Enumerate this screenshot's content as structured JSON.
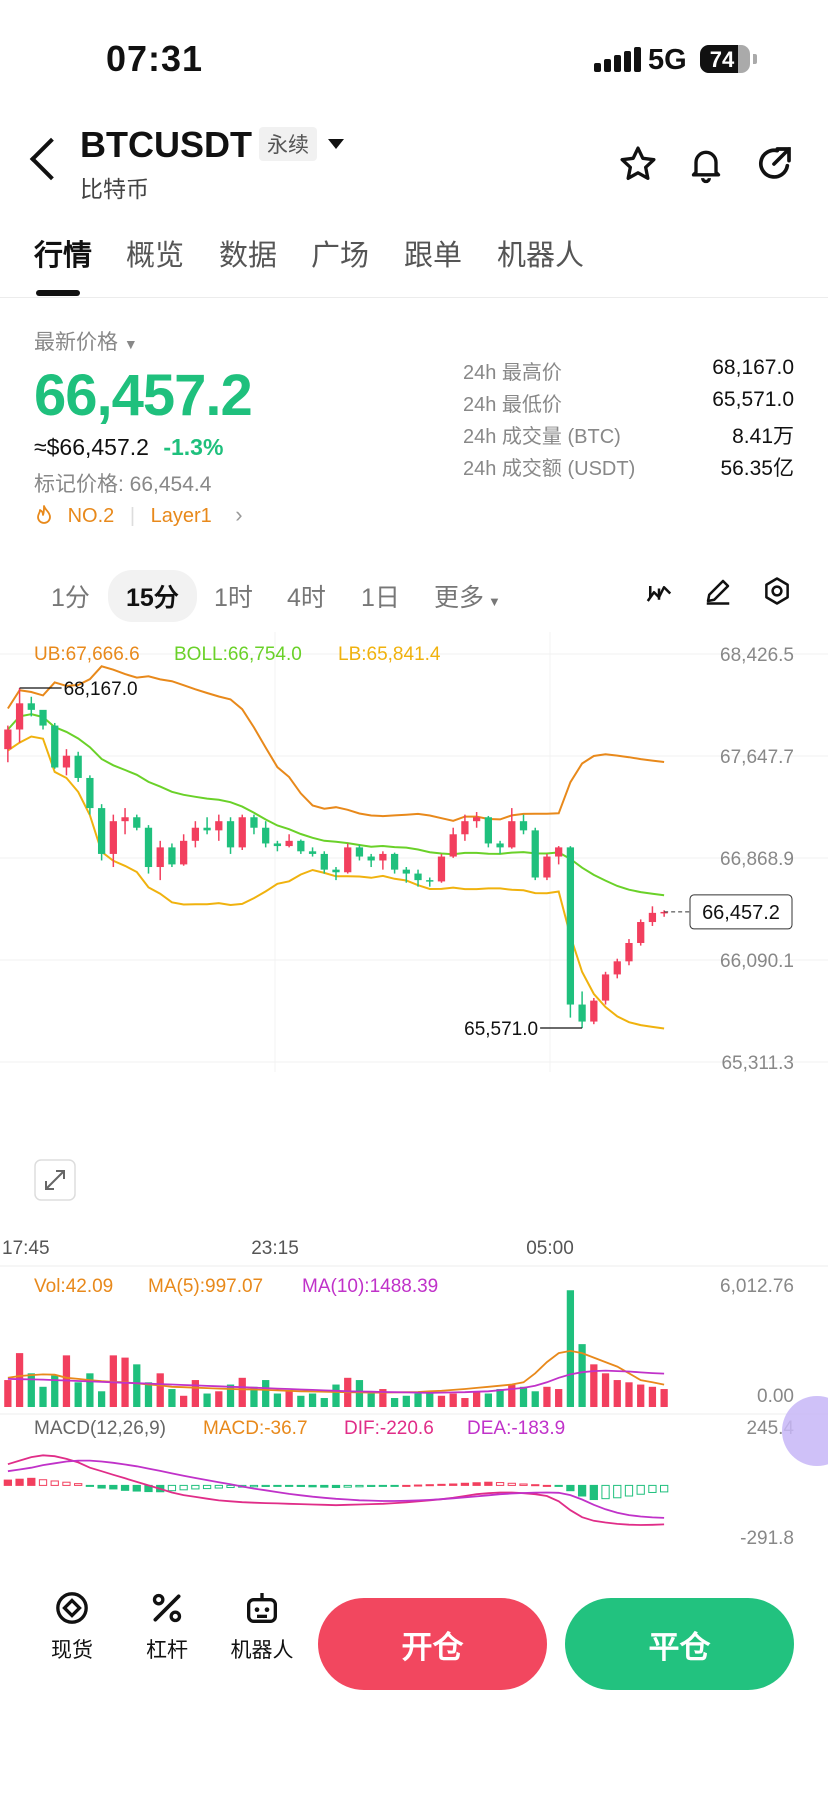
{
  "status": {
    "time": "07:31",
    "network": "5G",
    "battery": "74"
  },
  "header": {
    "symbol": "BTCUSDT",
    "contract_tag": "永续",
    "subtitle": "比特币"
  },
  "tabs": [
    "行情",
    "概览",
    "数据",
    "广场",
    "跟单",
    "机器人"
  ],
  "quote": {
    "label": "最新价格",
    "price": "66,457.2",
    "usd_price": "≈$66,457.2",
    "change": "-1.3%",
    "mark_price": "标记价格: 66,454.4",
    "rank": "NO.2",
    "category": "Layer1"
  },
  "stats": [
    {
      "label": "24h 最高价",
      "value": "68,167.0"
    },
    {
      "label": "24h 最低价",
      "value": "65,571.0"
    },
    {
      "label": "24h 成交量 (BTC)",
      "value": "8.41万"
    },
    {
      "label": "24h 成交额 (USDT)",
      "value": "56.35亿"
    }
  ],
  "intervals": [
    "1分",
    "15分",
    "1时",
    "4时",
    "1日",
    "更多"
  ],
  "intervals_active": "15分",
  "toolbar_icons": [
    "indicator-icon",
    "draw-pen-icon",
    "settings-icon"
  ],
  "colors": {
    "up": "#f23f5e",
    "down": "#1fc07d",
    "ub": "#e8891b",
    "boll": "#6ad129",
    "lb": "#f0b20e",
    "ma10": "#c032c9"
  },
  "chart_data": {
    "type": "candlestick",
    "interval": "15分",
    "boll": {
      "ub": "UB:67,666.6",
      "mid": "BOLL:66,754.0",
      "lb": "LB:65,841.4"
    },
    "price_axis": [
      "68,426.5",
      "67,647.7",
      "66,868.9",
      "66,090.1",
      "65,311.3"
    ],
    "ylim": [
      65311.3,
      68426.5
    ],
    "current_price": "66,457.2",
    "high_marker": "68,167.0",
    "low_marker": "65,571.0",
    "x_labels": [
      "17:45",
      "23:15",
      "05:00"
    ],
    "candles": [
      [
        67700,
        67880,
        67600,
        67850
      ],
      [
        67850,
        68167,
        67750,
        68050
      ],
      [
        68050,
        68100,
        67950,
        68000
      ],
      [
        68000,
        67980,
        67850,
        67880
      ],
      [
        67880,
        67900,
        67550,
        67560
      ],
      [
        67560,
        67700,
        67500,
        67650
      ],
      [
        67650,
        67680,
        67450,
        67480
      ],
      [
        67480,
        67500,
        67200,
        67250
      ],
      [
        67250,
        67280,
        66850,
        66900
      ],
      [
        66900,
        67200,
        66800,
        67150
      ],
      [
        67150,
        67250,
        67050,
        67180
      ],
      [
        67180,
        67200,
        67080,
        67100
      ],
      [
        67100,
        67120,
        66750,
        66800
      ],
      [
        66800,
        67000,
        66700,
        66950
      ],
      [
        66950,
        66980,
        66800,
        66820
      ],
      [
        66820,
        67050,
        66810,
        67000
      ],
      [
        67000,
        67150,
        66950,
        67100
      ],
      [
        67100,
        67180,
        67050,
        67080
      ],
      [
        67080,
        67200,
        67000,
        67150
      ],
      [
        67150,
        67180,
        66900,
        66950
      ],
      [
        66950,
        67200,
        66930,
        67180
      ],
      [
        67180,
        67200,
        67050,
        67100
      ],
      [
        67100,
        67150,
        66950,
        66980
      ],
      [
        66980,
        67000,
        66920,
        66960
      ],
      [
        66960,
        67050,
        66950,
        67000
      ],
      [
        67000,
        67010,
        66900,
        66920
      ],
      [
        66920,
        66950,
        66880,
        66900
      ],
      [
        66900,
        66920,
        66750,
        66780
      ],
      [
        66780,
        66800,
        66700,
        66760
      ],
      [
        66760,
        66980,
        66750,
        66950
      ],
      [
        66950,
        66970,
        66850,
        66880
      ],
      [
        66880,
        66900,
        66800,
        66850
      ],
      [
        66850,
        66920,
        66780,
        66900
      ],
      [
        66900,
        66910,
        66750,
        66780
      ],
      [
        66780,
        66800,
        66680,
        66750
      ],
      [
        66750,
        66780,
        66650,
        66700
      ],
      [
        66700,
        66720,
        66650,
        66690
      ],
      [
        66690,
        66900,
        66680,
        66880
      ],
      [
        66880,
        67100,
        66870,
        67050
      ],
      [
        67050,
        67200,
        67000,
        67150
      ],
      [
        67150,
        67220,
        67100,
        67180
      ],
      [
        67180,
        67190,
        66950,
        66980
      ],
      [
        66980,
        67000,
        66900,
        66950
      ],
      [
        66950,
        67250,
        66940,
        67150
      ],
      [
        67150,
        67200,
        67050,
        67080
      ],
      [
        67080,
        67100,
        66700,
        66720
      ],
      [
        66720,
        66900,
        66700,
        66880
      ],
      [
        66880,
        66960,
        66820,
        66950
      ],
      [
        66950,
        66960,
        65650,
        65750
      ],
      [
        65750,
        65850,
        65571,
        65620
      ],
      [
        65620,
        65800,
        65600,
        65780
      ],
      [
        65780,
        66000,
        65750,
        65980
      ],
      [
        65980,
        66100,
        65950,
        66080
      ],
      [
        66080,
        66250,
        66050,
        66220
      ],
      [
        66220,
        66400,
        66200,
        66380
      ],
      [
        66380,
        66500,
        66350,
        66450
      ],
      [
        66450,
        66470,
        66420,
        66457.2
      ]
    ],
    "volume": {
      "labels": [
        "Vol:42.09",
        "MA(5):997.07",
        "MA(10):1488.39"
      ],
      "axis": [
        "6,012.76",
        "0.00"
      ],
      "ylim": [
        0,
        6012.76
      ],
      "values": [
        1200,
        2400,
        1500,
        900,
        1400,
        2300,
        1100,
        1500,
        700,
        2300,
        2200,
        1900,
        1100,
        1500,
        800,
        500,
        1200,
        600,
        700,
        1000,
        1300,
        900,
        1200,
        600,
        700,
        500,
        600,
        400,
        1000,
        1300,
        1200,
        600,
        800,
        400,
        500,
        600,
        700,
        500,
        600,
        400,
        700,
        600,
        800,
        1000,
        900,
        700,
        900,
        800,
        5200,
        2800,
        1900,
        1500,
        1200,
        1100,
        1000,
        900,
        800
      ],
      "ma5": [
        1300,
        1380,
        1420,
        1450,
        1440,
        1300,
        1250,
        1200,
        1150,
        1120,
        1100,
        1050,
        1000,
        960,
        900,
        880,
        860,
        840,
        820,
        800,
        790,
        780,
        760,
        740,
        720,
        700,
        690,
        680,
        670,
        660,
        650,
        640,
        640,
        650,
        660,
        670,
        700,
        720,
        760,
        800,
        850,
        900,
        950,
        1000,
        1100,
        1500,
        2000,
        2400,
        2500,
        2400,
        2200,
        2000,
        1800,
        1500,
        1200,
        1100,
        997.07
      ],
      "ma10": [
        1250,
        1240,
        1230,
        1220,
        1200,
        1180,
        1160,
        1140,
        1120,
        1100,
        1080,
        1060,
        1040,
        1020,
        1000,
        980,
        960,
        940,
        920,
        900,
        880,
        860,
        840,
        820,
        800,
        780,
        760,
        740,
        720,
        700,
        690,
        680,
        670,
        660,
        650,
        640,
        630,
        640,
        650,
        660,
        680,
        700,
        750,
        800,
        850,
        950,
        1100,
        1300,
        1450,
        1550,
        1600,
        1620,
        1600,
        1580,
        1540,
        1510,
        1488.39
      ]
    },
    "macd": {
      "labels": [
        "MACD(12,26,9)",
        "MACD:-36.7",
        "DIF:-220.6",
        "DEA:-183.9"
      ],
      "axis": [
        "245.4",
        "-291.8"
      ],
      "ylim": [
        -291.8,
        245.4
      ],
      "hist": [
        30,
        35,
        40,
        32,
        25,
        18,
        10,
        -5,
        -15,
        -20,
        -28,
        -32,
        -35,
        -36,
        -30,
        -25,
        -20,
        -18,
        -15,
        -12,
        -10,
        -8,
        -6,
        -5,
        -4,
        -6,
        -8,
        -10,
        -12,
        -10,
        -8,
        -6,
        -4,
        -2,
        0,
        2,
        4,
        6,
        8,
        12,
        15,
        18,
        16,
        12,
        8,
        4,
        0,
        -5,
        -30,
        -60,
        -80,
        -75,
        -70,
        -60,
        -50,
        -40,
        -36.7
      ],
      "dif": [
        120,
        140,
        160,
        170,
        165,
        150,
        130,
        100,
        80,
        60,
        40,
        20,
        0,
        -20,
        -40,
        -55,
        -65,
        -75,
        -85,
        -90,
        -95,
        -98,
        -100,
        -102,
        -104,
        -106,
        -108,
        -110,
        -112,
        -110,
        -108,
        -106,
        -104,
        -100,
        -96,
        -90,
        -84,
        -78,
        -70,
        -60,
        -50,
        -44,
        -40,
        -40,
        -44,
        -50,
        -60,
        -90,
        -140,
        -180,
        -200,
        -210,
        -218,
        -222,
        -224,
        -223,
        -220.6
      ],
      "dea": [
        80,
        90,
        100,
        115,
        125,
        135,
        140,
        140,
        135,
        128,
        118,
        108,
        95,
        82,
        68,
        55,
        42,
        30,
        18,
        6,
        -6,
        -18,
        -28,
        -38,
        -48,
        -56,
        -64,
        -70,
        -76,
        -80,
        -84,
        -86,
        -88,
        -88,
        -87,
        -85,
        -82,
        -78,
        -73,
        -68,
        -62,
        -56,
        -50,
        -46,
        -43,
        -41,
        -40,
        -42,
        -55,
        -80,
        -110,
        -135,
        -155,
        -168,
        -176,
        -181,
        -183.9
      ]
    }
  },
  "bottom_nav": [
    {
      "label": "现货",
      "icon": "spot-icon"
    },
    {
      "label": "杠杆",
      "icon": "leverage-icon"
    },
    {
      "label": "机器人",
      "icon": "robot-icon"
    }
  ],
  "actions": {
    "open": "开仓",
    "close": "平仓"
  }
}
